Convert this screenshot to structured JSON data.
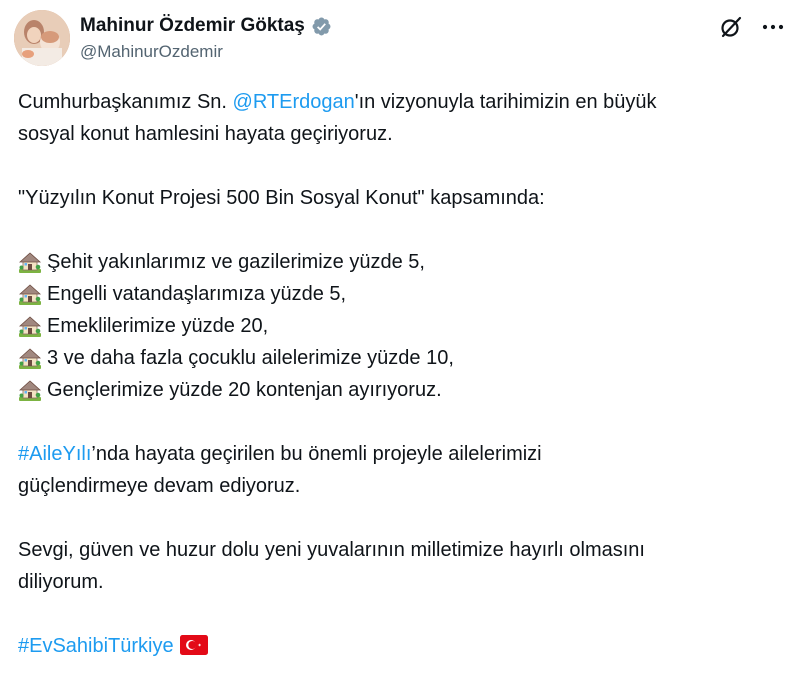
{
  "author": {
    "display_name": "Mahinur Özdemir Göktaş",
    "handle": "@MahinurOzdemir"
  },
  "icons": {
    "verified": "verified-badge-icon",
    "grok": "grok-icon",
    "more": "more-options-icon",
    "house": "house-with-garden-emoji",
    "flag": "turkey-flag-emoji"
  },
  "colors": {
    "link": "#1d9bf0",
    "text": "#0f1419",
    "secondary": "#536471",
    "verified_badge": "#829aab",
    "flag_red": "#e30a17"
  },
  "tweet": {
    "p1_before": "Cumhurbaşkanımız Sn. ",
    "p1_mention": "@RTErdogan",
    "p1_after": "'ın vizyonuyla tarihimizin en büyük",
    "p1_line2": "sosyal konut hamlesini hayata geçiriyoruz.",
    "p2": "\"Yüzyılın Konut Projesi 500 Bin Sosyal Konut\" kapsamında:",
    "list": [
      "Şehit yakınlarımız ve gazilerimize yüzde 5,",
      "Engelli vatandaşlarımıza yüzde 5,",
      "Emeklilerimize yüzde 20,",
      "3 ve daha fazla çocuklu ailelerimize yüzde 10,",
      "Gençlerimize yüzde 20 kontenjan ayırıyoruz."
    ],
    "p3_hashtag": "#AileYılı",
    "p3_after": "’nda hayata geçirilen bu önemli projeyle ailelerimizi",
    "p3_line2": "güçlendirmeye devam ediyoruz.",
    "p4_line1": "Sevgi, güven ve huzur dolu yeni yuvalarının milletimize hayırlı olmasını",
    "p4_line2": "diliyorum.",
    "p5_hashtag": "#EvSahibiTürkiye"
  }
}
